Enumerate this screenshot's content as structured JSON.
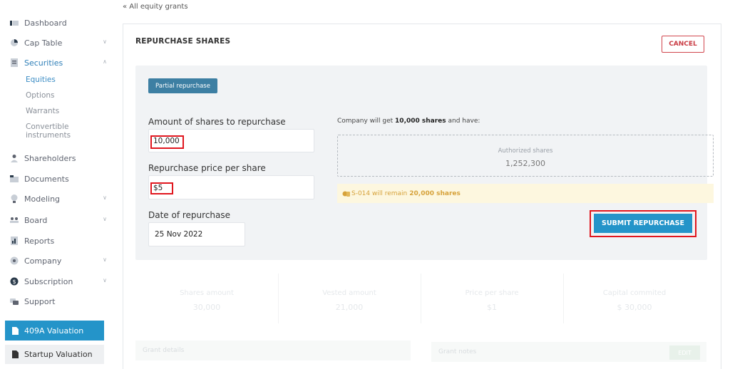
{
  "sidebar": {
    "items": [
      {
        "label": "Dashboard",
        "icon": "dashboard-icon"
      },
      {
        "label": "Cap Table",
        "icon": "pie-chart-icon"
      },
      {
        "label": "Securities",
        "icon": "document-icon"
      },
      {
        "label": "Shareholders",
        "icon": "person-icon"
      },
      {
        "label": "Documents",
        "icon": "folder-icon"
      },
      {
        "label": "Modeling",
        "icon": "bulb-icon"
      },
      {
        "label": "Board",
        "icon": "group-icon"
      },
      {
        "label": "Reports",
        "icon": "report-icon"
      },
      {
        "label": "Company",
        "icon": "building-icon"
      },
      {
        "label": "Subscription",
        "icon": "dollar-icon"
      },
      {
        "label": "Support",
        "icon": "support-icon"
      }
    ],
    "securities_sub": [
      "Equities",
      "Options",
      "Warrants",
      "Convertible",
      "instruments"
    ],
    "valuation_409a": "409A Valuation",
    "startup_valuation": "Startup Valuation"
  },
  "back_link": "« All equity grants",
  "card": {
    "title": "REPURCHASE SHARES",
    "cancel": "CANCEL",
    "tag": "Partial repurchase",
    "amount_label": "Amount of shares to repurchase",
    "amount_value": "10,000",
    "price_label": "Repurchase price per share",
    "price_value": "$5",
    "date_label": "Date of repurchase",
    "date_value": "25 Nov 2022",
    "company_get_prefix": "Company will get ",
    "company_get_bold": "10,000 shares",
    "company_get_suffix": " and have:",
    "authorized_label": "Authorized shares",
    "authorized_value": "1,252,300",
    "remain_prefix": "S-014 will remain",
    "remain_bold": "20,000 shares",
    "submit": "SUBMIT REPURCHASE"
  },
  "stats": [
    {
      "label": "Shares amount",
      "value": "30,000"
    },
    {
      "label": "Vested amount",
      "value": "21,000"
    },
    {
      "label": "Price per share",
      "value": "$1"
    },
    {
      "label": "Capital commited",
      "value": "$ 30,000"
    }
  ],
  "grant_details": "Grant details",
  "grant_notes": "Grant notes",
  "edit": "EDIT",
  "colors": {
    "accent": "#2494c9",
    "danger": "#e0161e",
    "tag": "#3d7fa3",
    "warning_bg": "#fdf7df"
  }
}
